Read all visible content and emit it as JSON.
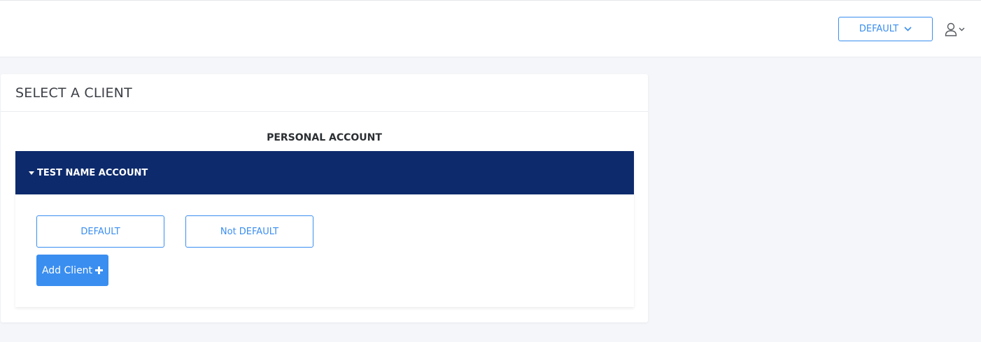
{
  "header": {
    "workspace_label": "DEFAULT",
    "workspace_icon": "chevron-down-icon",
    "user_icon": "user-icon",
    "user_menu_icon": "chevron-down-icon"
  },
  "card": {
    "title": "SELECT A CLIENT",
    "section_label": "PERSONAL ACCOUNT",
    "account": {
      "name": "TEST NAME ACCOUNT",
      "clients": [
        "DEFAULT",
        "Not DEFAULT"
      ],
      "add_label": "Add Client",
      "add_icon": "plus-icon"
    }
  },
  "colors": {
    "accent": "#3a8ef0",
    "account_header_bg": "#0d2a6c",
    "page_bg": "#f4f6fa"
  }
}
